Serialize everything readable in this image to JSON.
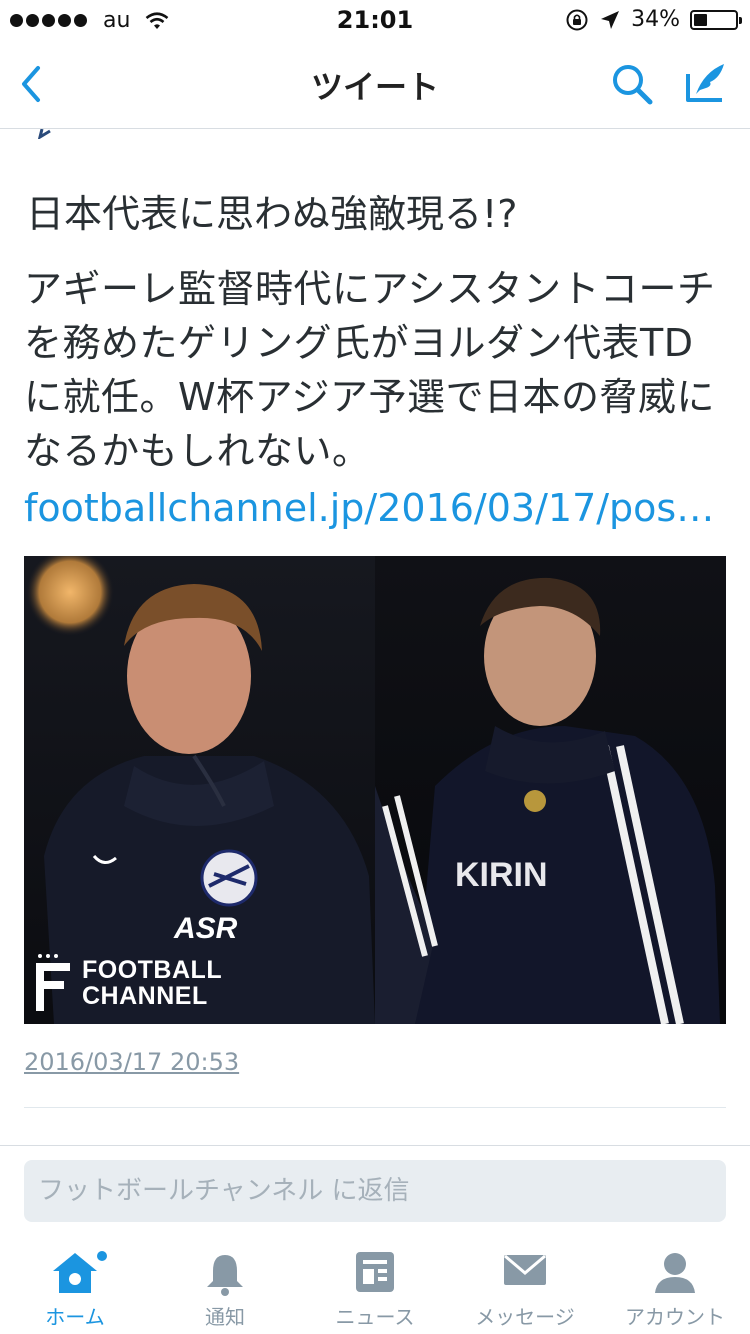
{
  "status_bar": {
    "carrier": "au",
    "time": "21:01",
    "battery": "34%"
  },
  "nav": {
    "title": "ツイート"
  },
  "tweet": {
    "headline": "日本代表に思わぬ強敵現る!?",
    "body": "アギーレ監督時代にアシスタントコーチを務めたゲリング氏がヨルダン代表TDに就任。W杯アジア予選で日本の脅威になるかもしれない。",
    "link": "footballchannel.jp/2016/03/17/pos…",
    "image_logo": {
      "line1": "FOOTBALL",
      "line2": "CHANNEL"
    },
    "timestamp": "2016/03/17 20:53"
  },
  "reply": {
    "placeholder": "フットボールチャンネル に返信"
  },
  "tabs": [
    {
      "label": "ホーム",
      "icon": "home-icon",
      "active": true
    },
    {
      "label": "通知",
      "icon": "bell-icon",
      "active": false
    },
    {
      "label": "ニュース",
      "icon": "news-icon",
      "active": false
    },
    {
      "label": "メッセージ",
      "icon": "envelope-icon",
      "active": false
    },
    {
      "label": "アカウント",
      "icon": "person-icon",
      "active": false
    }
  ],
  "colors": {
    "accent": "#1b95e0",
    "inactive": "#8899a6",
    "text": "#292f33"
  }
}
